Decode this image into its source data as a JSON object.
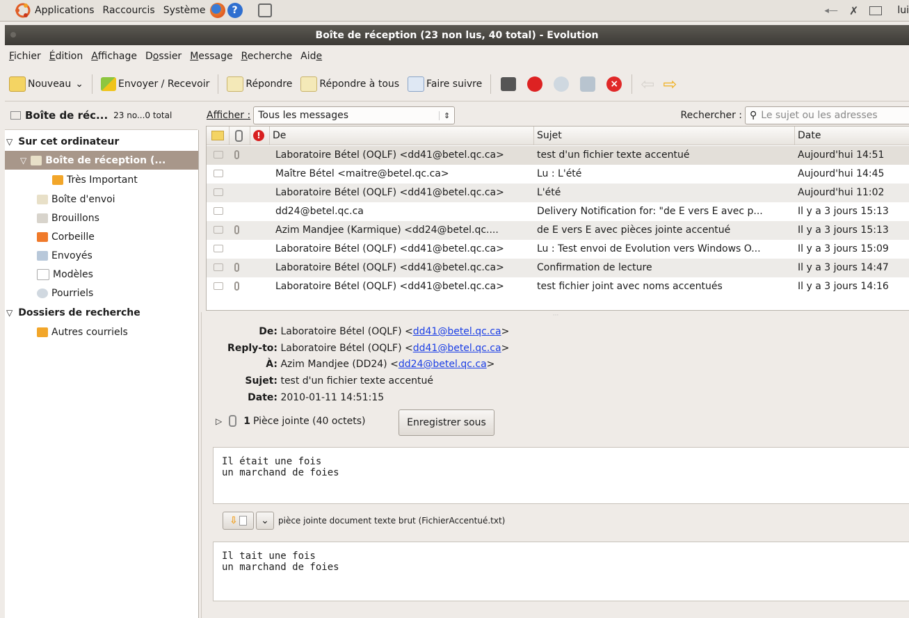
{
  "panel": {
    "menus": [
      "Applications",
      "Raccourcis",
      "Système"
    ],
    "user_fragment": "lui"
  },
  "window": {
    "title": "Boîte de réception (23 non lus, 40 total) - Evolution"
  },
  "menubar": [
    {
      "pre": "",
      "u": "F",
      "post": "ichier"
    },
    {
      "pre": "",
      "u": "É",
      "post": "dition"
    },
    {
      "pre": "",
      "u": "A",
      "post": "ffichage"
    },
    {
      "pre": "D",
      "u": "o",
      "post": "ssier"
    },
    {
      "pre": "",
      "u": "M",
      "post": "essage"
    },
    {
      "pre": "",
      "u": "R",
      "post": "echerche"
    },
    {
      "pre": "Aid",
      "u": "e",
      "post": ""
    }
  ],
  "toolbar": {
    "new": "Nouveau",
    "send_receive": "Envoyer / Recevoir",
    "reply": "Répondre",
    "reply_all": "Répondre à tous",
    "forward": "Faire suivre"
  },
  "left_header": {
    "folder": "Boîte de réc...",
    "counts": "23 no...0 total"
  },
  "tree": {
    "local_label": "Sur cet ordinateur",
    "inbox": "Boîte de réception (...",
    "important": "Très Important",
    "outbox": "Boîte d'envoi",
    "drafts": "Brouillons",
    "trash": "Corbeille",
    "sent": "Envoyés",
    "templates": "Modèles",
    "junk": "Pourriels",
    "search_label": "Dossiers de recherche",
    "other": "Autres courriels"
  },
  "filter": {
    "show_label": "Afficher :",
    "show_value": "Tous les messages",
    "search_label": "Rechercher :",
    "search_placeholder": "Le sujet ou les adresses"
  },
  "columns": {
    "from": "De",
    "subject": "Sujet",
    "date": "Date"
  },
  "messages": [
    {
      "from": "Laboratoire Bétel (OQLF) <dd41@betel.qc.ca>",
      "subject": "test d'un fichier texte accentué",
      "date": "Aujourd'hui 14:51",
      "attach": true,
      "selected": true
    },
    {
      "from": "Maître Bétel <maitre@betel.qc.ca>",
      "subject": "Lu : L'été",
      "date": "Aujourd'hui 14:45",
      "attach": false
    },
    {
      "from": "Laboratoire Bétel (OQLF) <dd41@betel.qc.ca>",
      "subject": "L'été",
      "date": "Aujourd'hui 11:02",
      "attach": false
    },
    {
      "from": "dd24@betel.qc.ca",
      "subject": "Delivery Notification for: \"de E vers E avec p...",
      "date": "Il y a 3 jours 15:13",
      "attach": false
    },
    {
      "from": "Azim Mandjee (Karmique) <dd24@betel.qc....",
      "subject": "de E vers E avec pièces jointe accentué",
      "date": "Il y a 3 jours 15:13",
      "attach": true
    },
    {
      "from": "Laboratoire Bétel (OQLF) <dd41@betel.qc.ca>",
      "subject": "Lu : Test envoi de Evolution vers Windows O...",
      "date": "Il y a 3 jours 15:09",
      "attach": false
    },
    {
      "from": "Laboratoire Bétel (OQLF) <dd41@betel.qc.ca>",
      "subject": "Confirmation de lecture",
      "date": "Il y a 3 jours 14:47",
      "attach": true
    },
    {
      "from": "Laboratoire Bétel (OQLF) <dd41@betel.qc.ca>",
      "subject": "test fichier joint avec noms accentués",
      "date": "Il y a 3 jours 14:16",
      "attach": true
    }
  ],
  "preview": {
    "from_key": "De:",
    "from_name": "Laboratoire Bétel (OQLF) <",
    "from_email": "dd41@betel.qc.ca",
    "reply_key": "Reply-to:",
    "reply_name": "Laboratoire Bétel (OQLF) <",
    "reply_email": "dd41@betel.qc.ca",
    "to_key": "À:",
    "to_name": "Azim Mandjee (DD24) <",
    "to_email": "dd24@betel.qc.ca",
    "subject_key": "Sujet:",
    "subject": "test d'un fichier texte accentué",
    "date_key": "Date:",
    "date": "2010-01-11 14:51:15",
    "close": ">",
    "attach_count": "1",
    "attach_text": "Pièce jointe (40 octets)",
    "save_as": "Enregistrer sous",
    "body1": "Il était une fois\nun marchand de foies",
    "attach_desc": "pièce jointe document texte brut (FichierAccentué.txt)",
    "body2": "Il tait une fois\nun marchand de foies"
  }
}
